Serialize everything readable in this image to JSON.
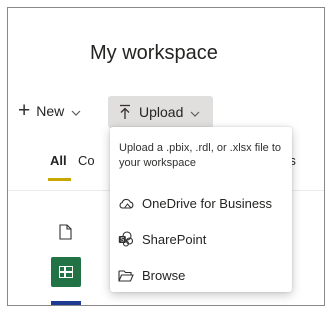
{
  "page": {
    "title": "My workspace"
  },
  "toolbar": {
    "new_label": "New",
    "upload_label": "Upload"
  },
  "tabs": {
    "all": "All",
    "content_partial": "Co",
    "right_partial": "ws"
  },
  "upload_menu": {
    "description": "Upload a .pbix, .rdl, or .xlsx file to your workspace",
    "items": [
      {
        "label": "OneDrive for Business",
        "icon": "cloud-icon"
      },
      {
        "label": "SharePoint",
        "icon": "sharepoint-icon"
      },
      {
        "label": "Browse",
        "icon": "folder-icon"
      }
    ]
  },
  "colors": {
    "upload_button_bg": "#e1dfdd",
    "tab_underline": "#c8a800",
    "excel_green": "#217346",
    "report_blue": "#1f3a93"
  }
}
